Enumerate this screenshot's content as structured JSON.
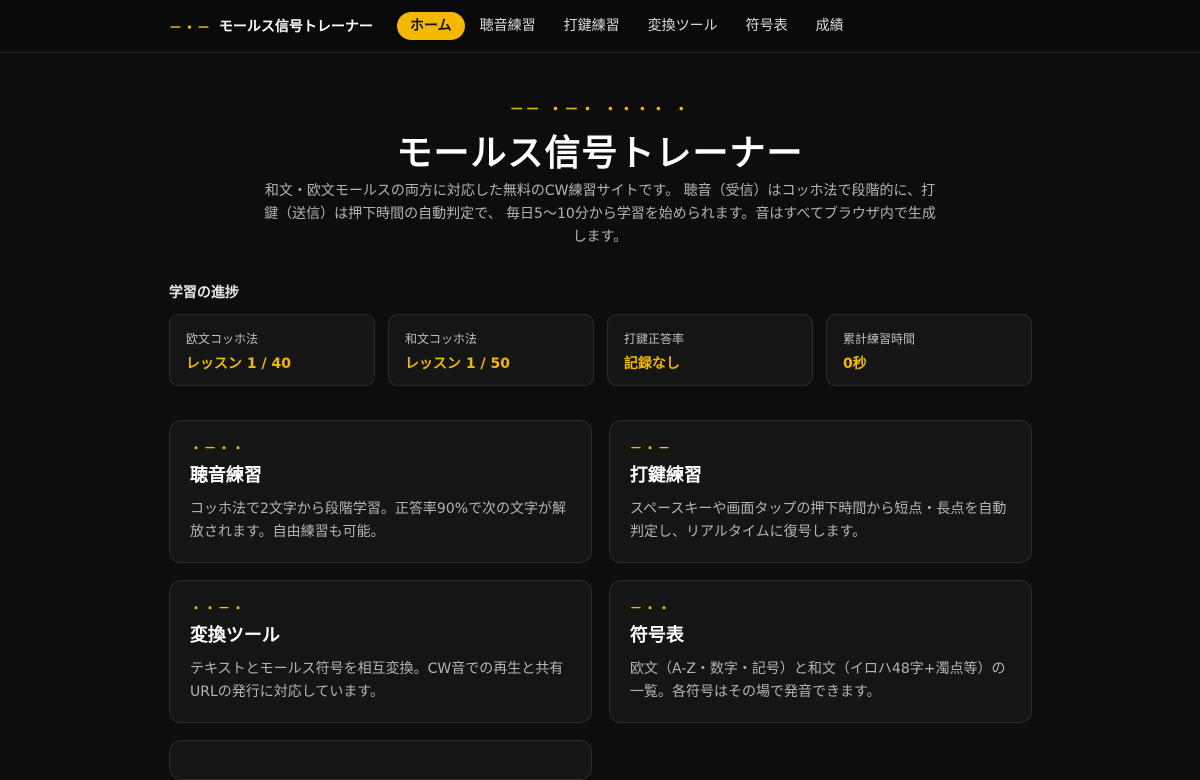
{
  "header": {
    "brand_mark": "－・－",
    "brand_name": "モールス信号トレーナー",
    "nav": [
      {
        "label": "ホーム",
        "active": true
      },
      {
        "label": "聴音練習",
        "active": false
      },
      {
        "label": "打鍵練習",
        "active": false
      },
      {
        "label": "変換ツール",
        "active": false
      },
      {
        "label": "符号表",
        "active": false
      },
      {
        "label": "成績",
        "active": false
      }
    ]
  },
  "hero": {
    "morse": "－－ ・－・ ・・・・ ・",
    "title": "モールス信号トレーナー",
    "description": "和文・欧文モールスの両方に対応した無料のCW練習サイトです。 聴音（受信）はコッホ法で段階的に、打鍵（送信）は押下時間の自動判定で、 毎日5〜10分から学習を始められます。音はすべてブラウザ内で生成します。"
  },
  "progress": {
    "title": "学習の進捗",
    "stats": [
      {
        "label": "欧文コッホ法",
        "value": "レッスン 1 / 40"
      },
      {
        "label": "和文コッホ法",
        "value": "レッスン 1 / 50"
      },
      {
        "label": "打鍵正答率",
        "value": "記録なし"
      },
      {
        "label": "累計練習時間",
        "value": "0秒"
      }
    ]
  },
  "features": [
    {
      "morse": "・－・・",
      "title": "聴音練習",
      "desc": "コッホ法で2文字から段階学習。正答率90%で次の文字が解放されます。自由練習も可能。"
    },
    {
      "morse": "－・－",
      "title": "打鍵練習",
      "desc": "スペースキーや画面タップの押下時間から短点・長点を自動判定し、リアルタイムに復号します。"
    },
    {
      "morse": "・・－・",
      "title": "変換ツール",
      "desc": "テキストとモールス符号を相互変換。CW音での再生と共有URLの発行に対応しています。"
    },
    {
      "morse": "－・・",
      "title": "符号表",
      "desc": "欧文（A-Z・数字・記号）と和文（イロハ48字+濁点等）の一覧。各符号はその場で発音できます。"
    }
  ],
  "colors": {
    "accent": "#f5b800",
    "background": "#0d0d0d",
    "card": "#151515"
  }
}
